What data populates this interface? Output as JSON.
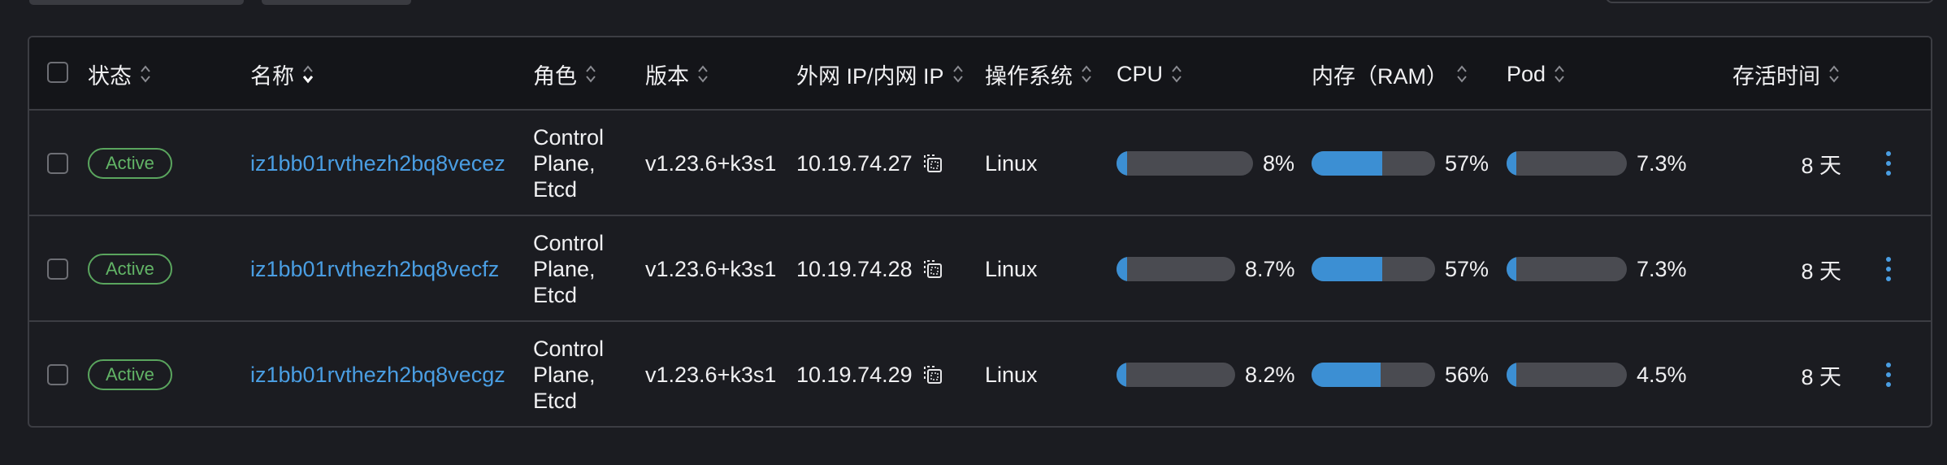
{
  "table": {
    "headers": {
      "status": "状态",
      "name": "名称",
      "role": "角色",
      "version": "版本",
      "ip": "外网 IP/内网 IP",
      "os": "操作系统",
      "cpu": "CPU",
      "ram": "内存（RAM）",
      "pod": "Pod",
      "age": "存活时间"
    },
    "rows": [
      {
        "status": "Active",
        "name": "iz1bb01rvthezh2bq8vecez",
        "role_line1": "Control",
        "role_line2": "Plane,",
        "role_line3": "Etcd",
        "version": "v1.23.6+k3s1",
        "ip": "10.19.74.27",
        "os": "Linux",
        "cpu": "8%",
        "cpu_fraction": 0.08,
        "ram": "57%",
        "ram_fraction": 0.57,
        "pod": "7.3%",
        "pod_fraction": 0.073,
        "age": "8 天"
      },
      {
        "status": "Active",
        "name": "iz1bb01rvthezh2bq8vecfz",
        "role_line1": "Control",
        "role_line2": "Plane,",
        "role_line3": "Etcd",
        "version": "v1.23.6+k3s1",
        "ip": "10.19.74.28",
        "os": "Linux",
        "cpu": "8.7%",
        "cpu_fraction": 0.087,
        "ram": "57%",
        "ram_fraction": 0.57,
        "pod": "7.3%",
        "pod_fraction": 0.073,
        "age": "8 天"
      },
      {
        "status": "Active",
        "name": "iz1bb01rvthezh2bq8vecgz",
        "role_line1": "Control",
        "role_line2": "Plane,",
        "role_line3": "Etcd",
        "version": "v1.23.6+k3s1",
        "ip": "10.19.74.29",
        "os": "Linux",
        "cpu": "8.2%",
        "cpu_fraction": 0.082,
        "ram": "56%",
        "ram_fraction": 0.56,
        "pod": "4.5%",
        "pod_fraction": 0.045,
        "age": "8 天"
      }
    ]
  },
  "colors": {
    "accent": "#4a9ee3",
    "active_badge": "#62b466",
    "bar_fill": "#3c8fd3",
    "bar_track": "#4a4b51"
  },
  "icons": {
    "sort": "sort-icon",
    "copy": "copy-icon",
    "row_actions": "kebab-menu-icon"
  }
}
